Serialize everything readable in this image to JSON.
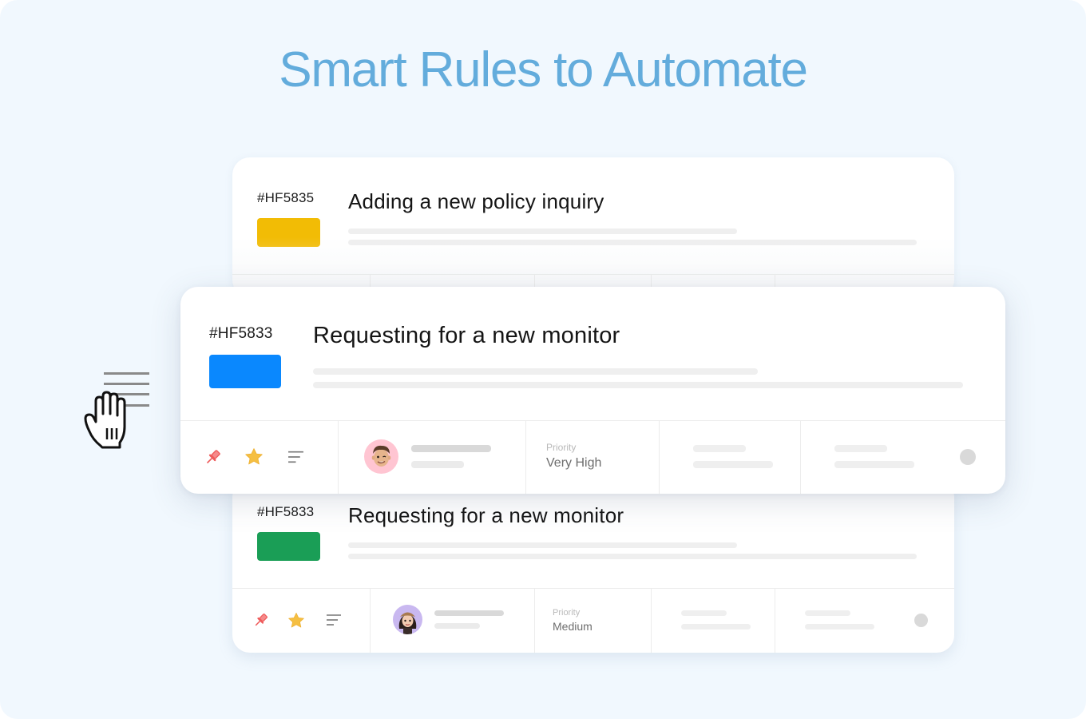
{
  "headline": "Smart Rules to Automate",
  "tickets": [
    {
      "id": "#HF5835",
      "title": "Adding a new policy inquiry",
      "tag_color": "#f2bc05",
      "state": "background-top"
    },
    {
      "id": "#HF5833",
      "title": "Requesting for a new monitor",
      "tag_color": "#0a88fe",
      "state": "dragged",
      "priority_label": "Priority",
      "priority_value": "Very High",
      "avatar_bg": "#ffc5d2",
      "actions": [
        "pin-icon",
        "star-icon",
        "sort-lines-icon"
      ]
    },
    {
      "id": "#HF5833",
      "title": "Requesting for a new monitor",
      "tag_color": "#1a9e56",
      "state": "background-bottom",
      "priority_label": "Priority",
      "priority_value": "Medium",
      "avatar_bg": "#c9b8f0",
      "actions": [
        "pin-icon",
        "star-icon",
        "sort-lines-icon"
      ]
    }
  ],
  "colors": {
    "pin": "#ef5b5b",
    "star": "#f5bf42",
    "headline": "#63acdc",
    "background": "#f1f8fe"
  },
  "cursor": "grab-hand-cursor"
}
